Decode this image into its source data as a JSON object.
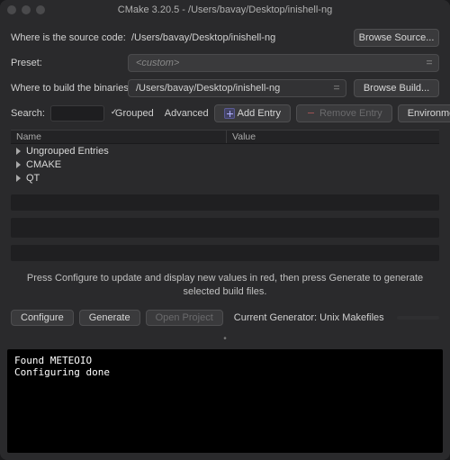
{
  "window": {
    "title": "CMake 3.20.5 - /Users/bavay/Desktop/inishell-ng"
  },
  "source": {
    "label": "Where is the source code:",
    "path": "/Users/bavay/Desktop/inishell-ng",
    "browse": "Browse Source..."
  },
  "preset": {
    "label": "Preset:",
    "value": "<custom>"
  },
  "build": {
    "label": "Where to build the binaries:",
    "path": "/Users/bavay/Desktop/inishell-ng",
    "browse": "Browse Build..."
  },
  "toolbar": {
    "search_label": "Search:",
    "search_value": "",
    "grouped_label": "Grouped",
    "grouped_checked": true,
    "advanced_label": "Advanced",
    "advanced_checked": false,
    "add_entry": "Add Entry",
    "remove_entry": "Remove Entry",
    "environment": "Environment..."
  },
  "tree": {
    "col_name": "Name",
    "col_value": "Value",
    "rows": [
      {
        "label": "Ungrouped Entries"
      },
      {
        "label": "CMAKE"
      },
      {
        "label": "QT"
      }
    ]
  },
  "hint": "Press Configure to update and display new values in red, then press Generate to generate selected build files.",
  "actions": {
    "configure": "Configure",
    "generate": "Generate",
    "open_project": "Open Project",
    "generator_label": "Current Generator: Unix Makefiles"
  },
  "console": "Found METEOIO\nConfiguring done"
}
